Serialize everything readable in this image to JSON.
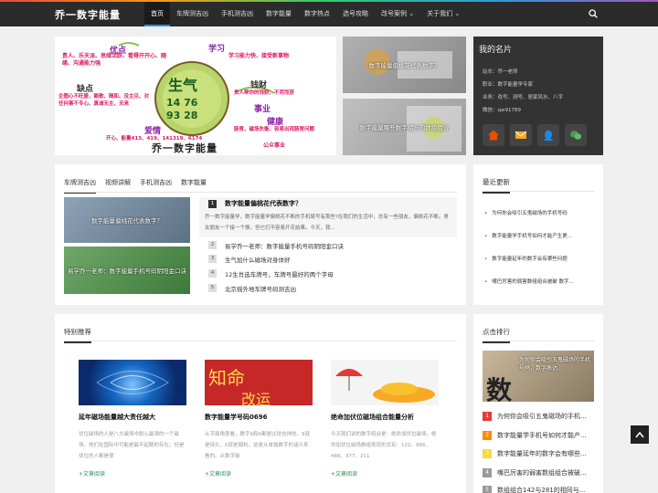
{
  "header": {
    "logo": "乔一数字能量",
    "nav": [
      {
        "label": "首页",
        "active": true
      },
      {
        "label": "车牌测吉凶"
      },
      {
        "label": "手机测吉凶"
      },
      {
        "label": "数字能量"
      },
      {
        "label": "数字热点"
      },
      {
        "label": "选号攻略"
      },
      {
        "label": "改号案例"
      },
      {
        "label": "关于我们"
      }
    ]
  },
  "banner": {
    "labels": {
      "youdian": "优点",
      "xuexi": "学习",
      "quedian": "缺点",
      "shengqi": "生气",
      "n1": "14 76",
      "n2": "93 28",
      "qiancai": "钱财",
      "shiye": "事业",
      "jiankang": "健康",
      "aiqing": "爱情",
      "caption": "乔一数字能量",
      "yd_text": "贵人、乐天派、思维活跃、看得开开心、随缘、沟通能力强",
      "xx_text": "学习能力快、接受新事物",
      "qd_text": "企图心不旺盛，赖散、随和、没主见、对任何事不专心、真诚无主、无来",
      "qc_text": "贵人帮你的钱财、不劳而获",
      "jk_text": "肠胃、磁场失衡、容易出现肠胃问题",
      "aq_text": "开心、能量413、419、141319、6174",
      "sy_text": "公众事业"
    }
  },
  "thumbs": [
    {
      "caption": "数字能量偏桃花代表数字？"
    },
    {
      "caption": "数字能量哪些数字组合的数组组合"
    }
  ],
  "profile": {
    "title": "我的名片",
    "lines": [
      "站长：乔一老师",
      "职业：数字能量学专家",
      "业务：改号、测号、居家风水、八字",
      "微信：qw91789"
    ]
  },
  "tabs": [
    "车牌测吉凶",
    "视频讲解",
    "手机测吉凶",
    "数字能量"
  ],
  "article_thumbs": [
    {
      "caption": "数字能量偏桃花代表数字？"
    },
    {
      "caption": "易学乔一老师：数字能量手机号码阴阳金口诀"
    }
  ],
  "featured": {
    "num": "1",
    "title": "数字能量偏桃花代表数字？",
    "excerpt": "乔一数字能量学，数字能量学偏桃花不断的手机尾号有那些?在我们的生活中，总有一些朋友，偏桃花不断。男女朋友一个接一个换，但它们不容易开花结果。今天，我..."
  },
  "article_list": [
    {
      "num": "2",
      "title": "易学乔一老师：数字能量手机号码阴阳金口诀"
    },
    {
      "num": "3",
      "title": "生气加什么磁场对身体好"
    },
    {
      "num": "4",
      "title": "12生肖选车牌号，车牌号最好的两个字母"
    },
    {
      "num": "5",
      "title": "北京摇外地车牌号码测吉凶"
    }
  ],
  "recent": {
    "title": "最近更新",
    "items": [
      "为何你会吸引五鬼磁场的手机号码",
      "数字能量学手机号如何才能产生更...",
      "数字能量延年的数字会有哪些问题",
      "",
      "嘴巴厉害的弱害数组组合被破 数字..."
    ]
  },
  "special": {
    "title": "特别推荐",
    "cards": [
      {
        "title": "延年磁场能量越大责任越大",
        "excerpt": "伏位磁场的人是八大磁场中耐心最强的一个磁场，他们在国际中可能是最不起眼的存在，但是伏位的人都是很",
        "more": "+文章阅读"
      },
      {
        "title": "数字能量学号码0696",
        "excerpt": "从字面角度看，数字9和6都是比较吉祥的。9就是持久，6就是顺利，这是从单独数字的涵义来看的。从数字能",
        "more": "+文章阅读",
        "img_text1": "知命",
        "img_text2": "改运"
      },
      {
        "title": "绝命加伏位磁场组合能量分析",
        "excerpt": "今天我们讲的数字组合是：绝命加伏位磁场，绝命加伏位磁场数组表现形式有：122、866、488、377、211",
        "more": "+文章阅读"
      }
    ]
  },
  "ranking": {
    "title": "点击排行",
    "img_caption": "为何你会吸引五鬼磁场的手机号码，数字表达...",
    "img_big": "数",
    "items": [
      {
        "num": "1",
        "title": "为何你会吸引五鬼磁场的手机..."
      },
      {
        "num": "2",
        "title": "数字能量学手机号如何才能产..."
      },
      {
        "num": "3",
        "title": "数字能量延年的数字会有哪些..."
      },
      {
        "num": "4",
        "title": "嘴巴厉害的弱害数组组合被破..."
      },
      {
        "num": "5",
        "title": "数组组合142与281的相同与..."
      }
    ]
  },
  "colors": {
    "header_bg": "#2b2b2b",
    "accent": "#2196f3",
    "link_green": "#2e8b57"
  }
}
